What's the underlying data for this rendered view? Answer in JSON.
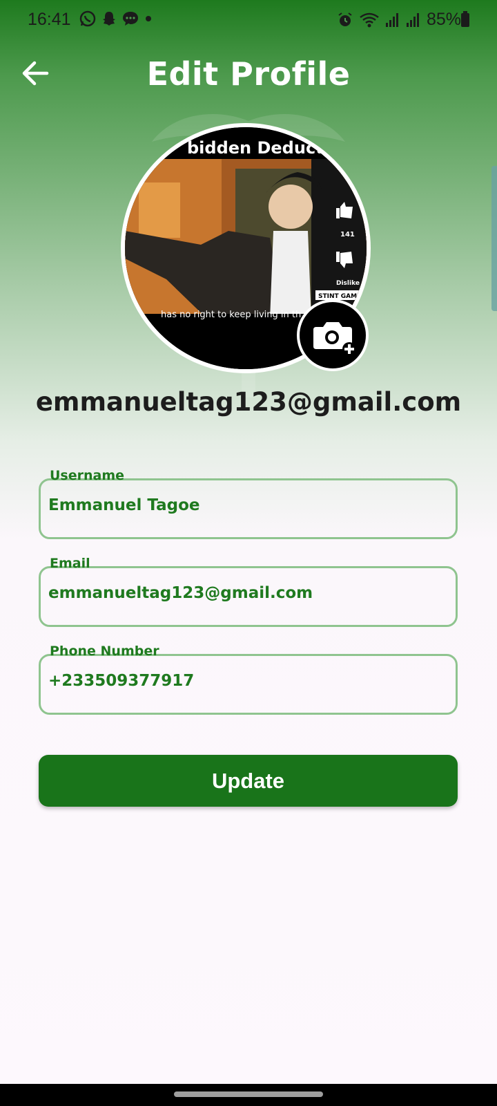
{
  "status_bar": {
    "time": "16:41",
    "battery": "85%",
    "left_icons": [
      "whatsapp-icon",
      "snapchat-icon",
      "chat-icon",
      "dot-icon"
    ],
    "right_icons": [
      "alarm-icon",
      "wifi-icon",
      "signal-icon",
      "signal-icon",
      "battery-icon"
    ]
  },
  "header": {
    "title": "Edit Profile",
    "back_icon": "arrow-left-icon"
  },
  "avatar": {
    "banner_text": "bidden Deductio",
    "subtitle_text": "has no right to keep living in th",
    "like_count": "141",
    "dislike_label": "Dislike",
    "channel_text": "STINT GAMES",
    "camera_icon": "camera-add-icon"
  },
  "profile": {
    "email": "emmanueltag123@gmail.com"
  },
  "form": {
    "username_label": "Username",
    "username_value": "Emmanuel Tagoe",
    "email_label": "Email",
    "email_value": "emmanueltag123@gmail.com",
    "phone_label": "Phone Number",
    "phone_value": "+233509377917",
    "update_label": "Update"
  },
  "colors": {
    "primary": "#19741a",
    "field_border": "#8fc48f",
    "field_text": "#1f7a1f"
  }
}
